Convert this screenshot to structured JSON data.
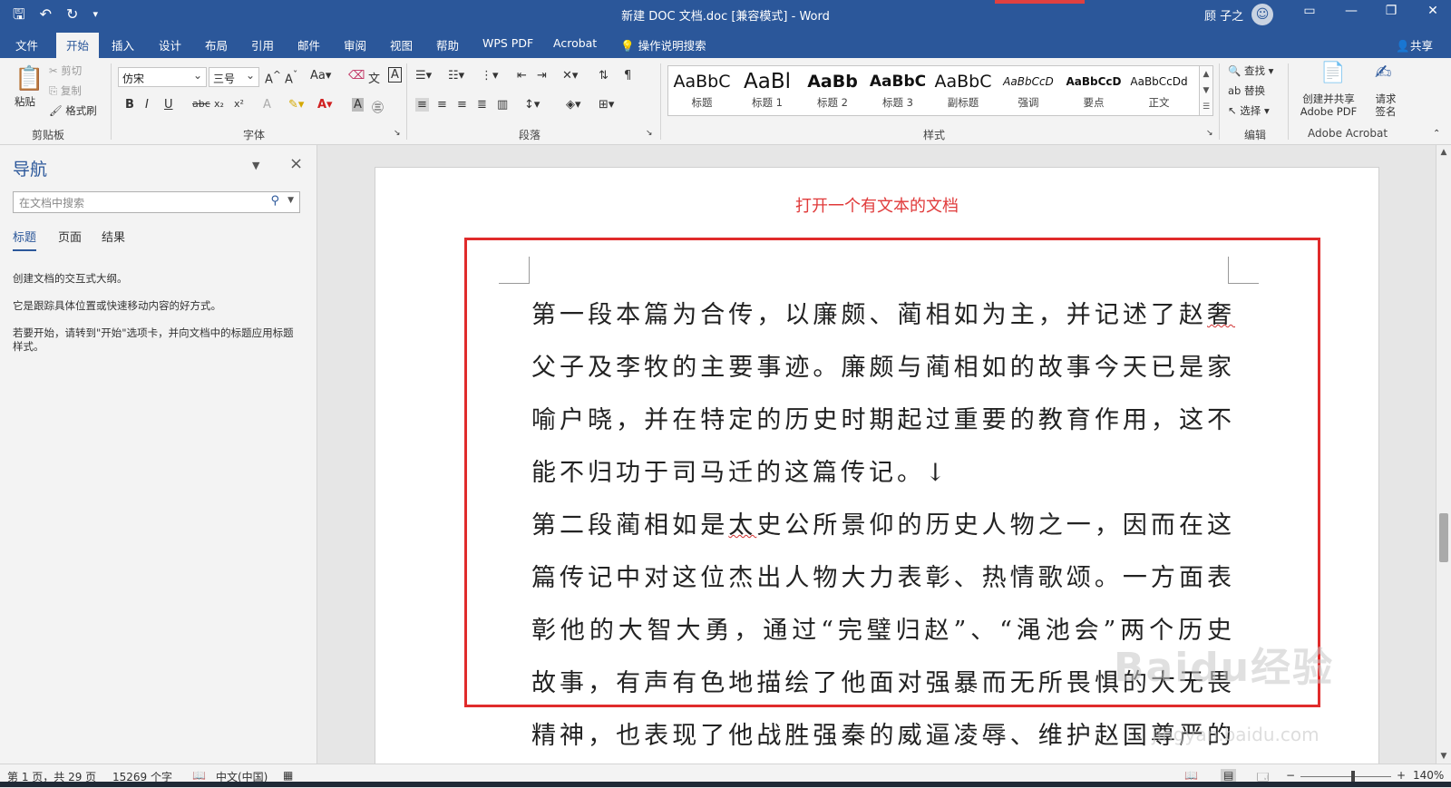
{
  "window": {
    "title": "新建 DOC 文档.doc [兼容模式]  -  Word",
    "user": "顾 子之",
    "qat_icons": [
      "save-icon",
      "undo-icon",
      "redo-icon",
      "customize-icon"
    ]
  },
  "tabs": [
    "文件",
    "开始",
    "插入",
    "设计",
    "布局",
    "引用",
    "邮件",
    "审阅",
    "视图",
    "帮助",
    "WPS PDF",
    "Acrobat"
  ],
  "tell_me": "操作说明搜索",
  "share": "共享",
  "ribbon": {
    "clipboard": {
      "paste": "粘贴",
      "cut": "剪切",
      "copy": "复制",
      "format_painter": "格式刷",
      "label": "剪贴板"
    },
    "font": {
      "name": "仿宋",
      "size": "三号",
      "label": "字体"
    },
    "paragraph": {
      "label": "段落"
    },
    "styles": {
      "label": "样式",
      "items": [
        {
          "preview": "AaBbC",
          "name": "标题"
        },
        {
          "preview": "AaBl",
          "name": "标题 1"
        },
        {
          "preview": "AaBb",
          "name": "标题 2"
        },
        {
          "preview": "AaBbC",
          "name": "标题 3"
        },
        {
          "preview": "AaBbC",
          "name": "副标题"
        },
        {
          "preview": "AaBbCcD",
          "name": "强调"
        },
        {
          "preview": "AaBbCcD",
          "name": "要点"
        },
        {
          "preview": "AaBbCcDd",
          "name": "正文"
        }
      ]
    },
    "editing": {
      "find": "查找",
      "replace": "替换",
      "select": "选择",
      "label": "编辑"
    },
    "acrobat": {
      "create": "创建并共享\nAdobe PDF",
      "create_l1": "创建并共享",
      "create_l2": "Adobe PDF",
      "sign_l1": "请求",
      "sign_l2": "签名",
      "label": "Adobe Acrobat"
    }
  },
  "nav": {
    "title": "导航",
    "search_placeholder": "在文档中搜索",
    "tabs": [
      "标题",
      "页面",
      "结果"
    ],
    "help": [
      "创建文档的交互式大纲。",
      "它是跟踪具体位置或快速移动内容的好方式。",
      "若要开始，请转到\"开始\"选项卡，并向文档中的标题应用标题样式。"
    ]
  },
  "document": {
    "annotation": "打开一个有文本的文档",
    "p1_a": "第一段本篇为合传，以廉颇、蔺相如为主，并记述了赵",
    "p1_sq": "奢",
    "p1_b": "父子及李牧的主要事迹。廉颇与蔺相如的故事今天已是家喻户晓，并在特定的历史时期起过重要的教育作用，这不能不归功于司马迁的这篇传记。↓",
    "p2_a": "第二段蔺相如是",
    "p2_sq": "太",
    "p2_b": "史公所景仰的历史人物之一，因而在这篇传记中对这位杰出人物大力表彰、热情歌颂。一方面表彰他的大智大勇，通过“完璧归赵”、“渑池会”两个历史故事，有声有色地描绘了他面对强暴而无所畏惧的大无畏精神，也表现了他战胜强秦的威逼凌辱、维护赵国尊严的机智与果",
    "watermark": "Baidu经验",
    "watermark_url": "jingyan.baidu.com"
  },
  "status": {
    "page": "第 1 页，共 29 页",
    "words": "15269 个字",
    "lang": "中文(中国)",
    "zoom": "140%"
  }
}
